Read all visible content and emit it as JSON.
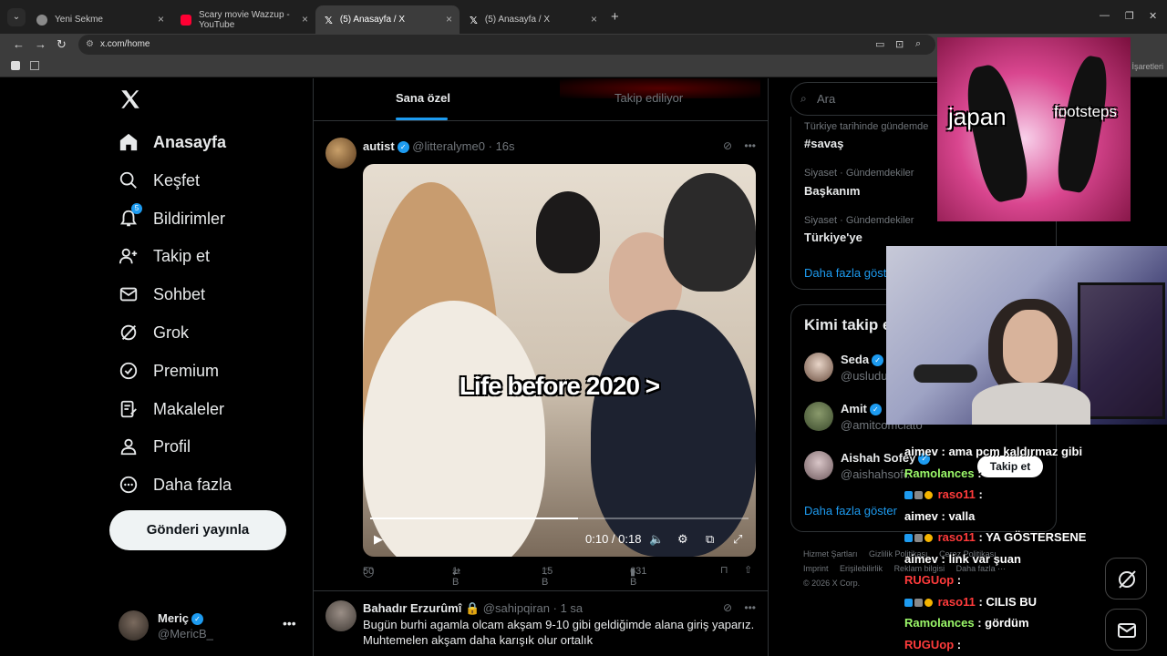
{
  "browser": {
    "tabs": [
      {
        "title": "Yeni Sekme",
        "active": false
      },
      {
        "title": "Scary movie Wazzup - YouTube",
        "active": false
      },
      {
        "title": "(5) Anasayfa / X",
        "active": true
      },
      {
        "title": "(5) Anasayfa / X",
        "active": false
      }
    ],
    "url": "x.com/home",
    "bookmarks_right": "r İşaretleri"
  },
  "sidebar": {
    "items": [
      {
        "label": "Anasayfa",
        "icon": "home-icon"
      },
      {
        "label": "Keşfet",
        "icon": "search-icon"
      },
      {
        "label": "Bildirimler",
        "icon": "bell-icon",
        "badge": "5"
      },
      {
        "label": "Takip et",
        "icon": "follow-icon"
      },
      {
        "label": "Sohbet",
        "icon": "mail-icon"
      },
      {
        "label": "Grok",
        "icon": "grok-icon"
      },
      {
        "label": "Premium",
        "icon": "premium-icon"
      },
      {
        "label": "Makaleler",
        "icon": "article-icon"
      },
      {
        "label": "Profil",
        "icon": "profile-icon"
      },
      {
        "label": "Daha fazla",
        "icon": "more-icon"
      }
    ],
    "post_button": "Gönderi yayınla",
    "profile": {
      "name": "Meriç",
      "handle": "@MericB_"
    }
  },
  "feed": {
    "tabs": [
      "Sana özel",
      "Takip ediliyor"
    ],
    "tweet1": {
      "name": "autist",
      "handle": "@litteralyme0",
      "time": "16s",
      "video_caption": "Life before 2020 >",
      "video_time": "0:10 / 0:18",
      "progress": 0.55,
      "replies": "50",
      "retweets": "1 B",
      "likes": "15 B",
      "views": "631 B"
    },
    "tweet2": {
      "name": "Bahadır Erzurûmî",
      "handle": "@sahipqiran",
      "time": "1 sa",
      "text": "Bugün burhi agamla olcam akşam 9-10 gibi geldiğimde alana giriş yaparız. Muhtemelen akşam daha karışık olur ortalık"
    }
  },
  "right": {
    "search_placeholder": "Ara",
    "trends": [
      {
        "category": "Türkiye tarihinde gündemde",
        "name": "#savaş"
      },
      {
        "category": "Siyaset · Gündemdekiler",
        "name": "Başkanım"
      },
      {
        "category": "Siyaset · Gündemdekiler",
        "name": "Türkiye'ye"
      }
    ],
    "show_more": "Daha fazla göster",
    "follow_title": "Kimi takip e",
    "suggestions": [
      {
        "name": "Seda",
        "handle": "@usludu"
      },
      {
        "name": "Amit",
        "handle": "@amitcomciato"
      },
      {
        "name": "Aishah Sofey",
        "handle": "@aishahsofe"
      }
    ],
    "show_more2": "Daha fazla göster",
    "footer": [
      "Hizmet Şartları",
      "Gizlilik Politikası",
      "Çerez Politikası",
      "Imprint",
      "Erişilebilirlik",
      "Reklam bilgisi",
      "Daha fazla ···",
      "© 2026 X Corp."
    ]
  },
  "overlay": {
    "word1": "japan",
    "word2": "footsteps",
    "takip_pill": "Takip et",
    "chat": [
      {
        "user": "aimev",
        "msg": "ama pcm kaldırmaz gibi",
        "color": "white",
        "badges": false
      },
      {
        "user": "Ramolances",
        "msg": "",
        "color": "green",
        "badges": false
      },
      {
        "user": "raso11",
        "msg": "",
        "color": "red",
        "badges": true
      },
      {
        "user": "aimev",
        "msg": "valla",
        "color": "white",
        "badges": false
      },
      {
        "user": "raso11",
        "msg": "YA GÖSTERSENE",
        "color": "red",
        "badges": true
      },
      {
        "user": "aimev",
        "msg": "link var şuan",
        "color": "white",
        "badges": false
      },
      {
        "user": "RUGUop",
        "msg": "",
        "color": "red",
        "badges": false
      },
      {
        "user": "raso11",
        "msg": "CILIS BU",
        "color": "red",
        "badges": true
      },
      {
        "user": "Ramolances",
        "msg": "gördüm",
        "color": "green",
        "badges": false
      },
      {
        "user": "RUGUop",
        "msg": "",
        "color": "red",
        "badges": false
      }
    ]
  }
}
